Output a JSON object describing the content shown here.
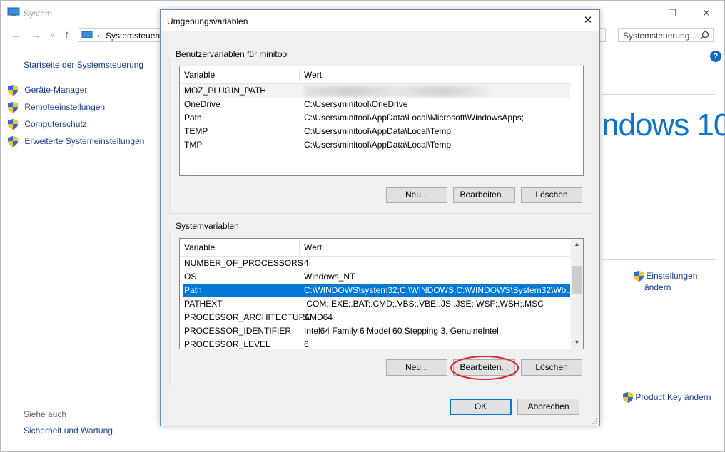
{
  "system_window": {
    "title": "System",
    "address": "Systemsteuerung",
    "search_placeholder": "Systemsteuerung ...",
    "sidebar": {
      "home_link": "Startseite der Systemsteuerung",
      "items": [
        {
          "label": "Geräte-Manager"
        },
        {
          "label": "Remoteeinstellungen"
        },
        {
          "label": "Computerschutz"
        },
        {
          "label": "Erweiterte Systemeinstellungen"
        }
      ],
      "see_also": "Siehe auch",
      "see_also_link": "Sicherheit und Wartung"
    },
    "windows_logo_text": "ndows 10",
    "change_settings_line1": "Einstellungen",
    "change_settings_line2": "ändern",
    "product_key_link": "Product Key ändern"
  },
  "dialog": {
    "title": "Umgebungsvariablen",
    "user_group": {
      "label": "Benutzervariablen für minitool",
      "columns": [
        "Variable",
        "Wert"
      ],
      "rows": [
        {
          "name": "MOZ_PLUGIN_PATH",
          "value": ""
        },
        {
          "name": "OneDrive",
          "value": "C:\\Users\\minitool\\OneDrive"
        },
        {
          "name": "Path",
          "value": "C:\\Users\\minitool\\AppData\\Local\\Microsoft\\WindowsApps;"
        },
        {
          "name": "TEMP",
          "value": "C:\\Users\\minitool\\AppData\\Local\\Temp"
        },
        {
          "name": "TMP",
          "value": "C:\\Users\\minitool\\AppData\\Local\\Temp"
        }
      ],
      "buttons": {
        "new": "Neu...",
        "edit": "Bearbeiten...",
        "delete": "Löschen"
      }
    },
    "system_group": {
      "label": "Systemvariablen",
      "columns": [
        "Variable",
        "Wert"
      ],
      "rows": [
        {
          "name": "NUMBER_OF_PROCESSORS",
          "value": "4"
        },
        {
          "name": "OS",
          "value": "Windows_NT"
        },
        {
          "name": "Path",
          "value": "C:\\WINDOWS\\system32;C:\\WINDOWS;C:\\WINDOWS\\System32\\Wb..."
        },
        {
          "name": "PATHEXT",
          "value": ".COM;.EXE;.BAT;.CMD;.VBS;.VBE;.JS;.JSE;.WSF;.WSH;.MSC"
        },
        {
          "name": "PROCESSOR_ARCHITECTURE",
          "value": "AMD64"
        },
        {
          "name": "PROCESSOR_IDENTIFIER",
          "value": "Intel64 Family 6 Model 60 Stepping 3, GenuineIntel"
        },
        {
          "name": "PROCESSOR_LEVEL",
          "value": "6"
        }
      ],
      "selected_row": "Path",
      "buttons": {
        "new": "Neu...",
        "edit": "Bearbeiten...",
        "delete": "Löschen"
      }
    },
    "ok_label": "OK",
    "cancel_label": "Abbrechen"
  },
  "colors": {
    "selection": "#0078d7",
    "link": "#1c3f8f",
    "highlight_circle": "#d9262b",
    "windows_blue": "#0a74c9"
  }
}
